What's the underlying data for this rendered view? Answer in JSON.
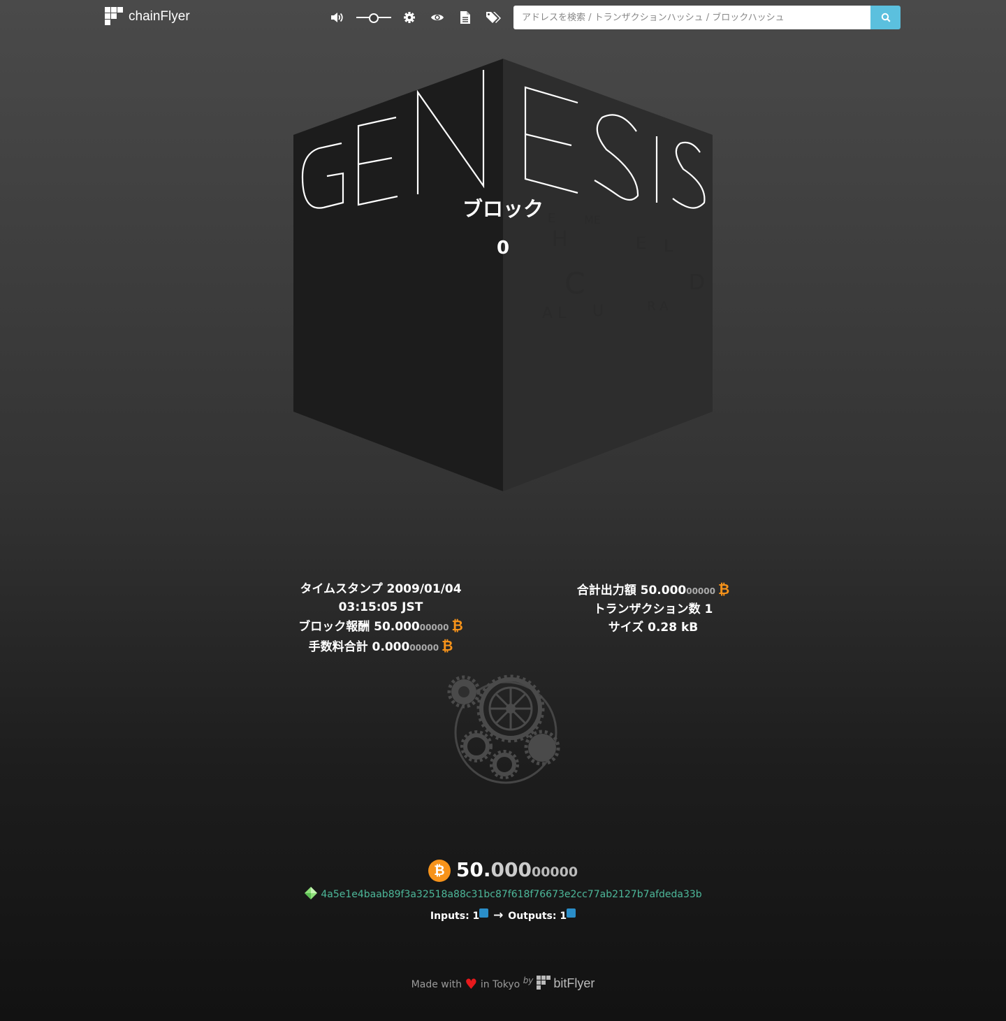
{
  "header": {
    "brand": "chainFlyer",
    "search_placeholder": "アドレスを検索 / トランザクションハッシュ / ブロックハッシュ",
    "icons": [
      "volume-icon",
      "volume-slider",
      "gear-icon",
      "eye-icon",
      "document-icon",
      "tags-icon",
      "search-icon"
    ]
  },
  "block": {
    "title_art": "GENESIS",
    "label": "ブロック",
    "height": "0"
  },
  "details": {
    "timestamp_label": "タイムスタンプ",
    "timestamp_date": "2009/01/04",
    "timestamp_time": "03:15:05 JST",
    "reward_label": "ブロック報酬",
    "reward_main": "50.000",
    "reward_small": "00000",
    "fee_label": "手数料合計",
    "fee_main": "0.000",
    "fee_small": "00000",
    "total_out_label": "合計出力額",
    "total_out_main": "50.000",
    "total_out_small": "00000",
    "tx_count_label": "トランザクション数",
    "tx_count": "1",
    "size_label": "サイズ",
    "size_value": "0.28 kB",
    "btc_symbol": "₿"
  },
  "transaction": {
    "amount_int": "50.",
    "amount_dim": "000",
    "amount_small": "00000",
    "hash": "4a5e1e4baab89f3a32518a88c31bc87f618f76673e2cc77ab2127b7afdeda33b",
    "inputs_label": "Inputs:",
    "inputs_count": "1",
    "arrow": "→",
    "outputs_label": "Outputs:",
    "outputs_count": "1"
  },
  "footer": {
    "made_with": "Made with",
    "in_tokyo": "in Tokyo",
    "by": "by",
    "company": "bitFlyer"
  },
  "colors": {
    "accent": "#5bc0de",
    "bitcoin": "#f7931a",
    "hash": "#4db89a",
    "heart": "#e8191c"
  }
}
